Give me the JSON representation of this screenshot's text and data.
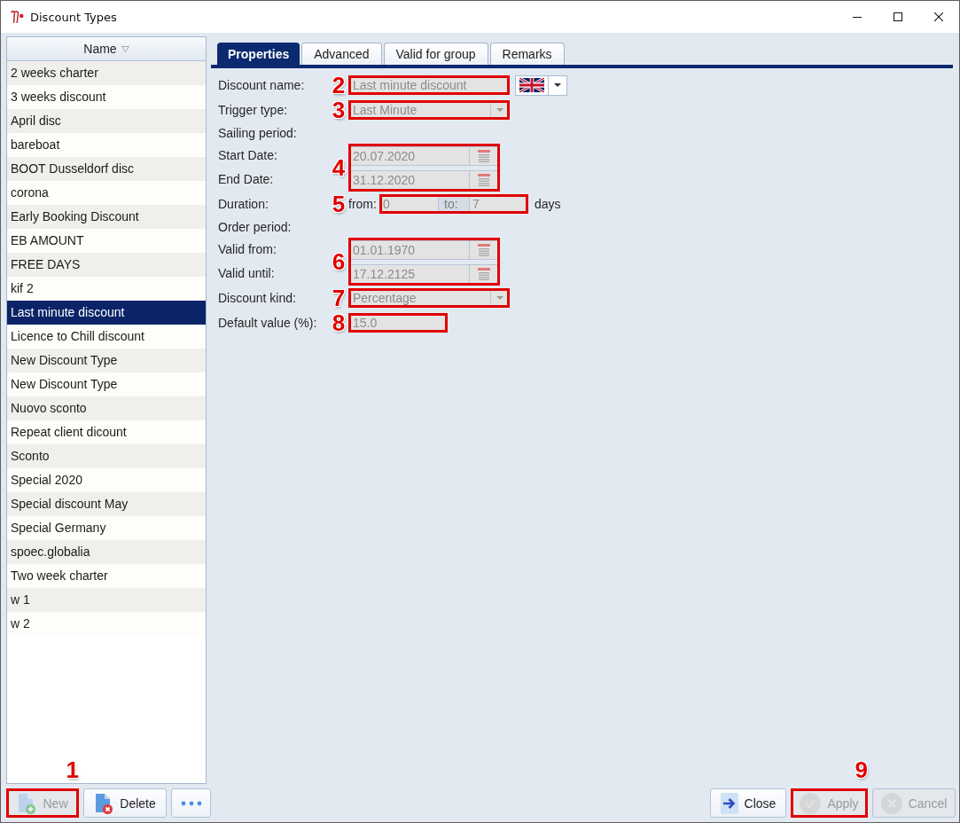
{
  "window": {
    "title": "Discount Types"
  },
  "list": {
    "header": "Name",
    "items": [
      {
        "label": "2 weeks charter",
        "selected": false
      },
      {
        "label": "3 weeks discount",
        "selected": false
      },
      {
        "label": "April disc",
        "selected": false
      },
      {
        "label": "bareboat",
        "selected": false
      },
      {
        "label": "BOOT Dusseldorf disc",
        "selected": false
      },
      {
        "label": "corona",
        "selected": false
      },
      {
        "label": "Early Booking Discount",
        "selected": false
      },
      {
        "label": "EB AMOUNT",
        "selected": false
      },
      {
        "label": "FREE DAYS",
        "selected": false
      },
      {
        "label": "kif 2",
        "selected": false
      },
      {
        "label": "Last minute discount",
        "selected": true
      },
      {
        "label": "Licence to Chill discount",
        "selected": false
      },
      {
        "label": "New Discount Type",
        "selected": false
      },
      {
        "label": "New Discount Type",
        "selected": false
      },
      {
        "label": "Nuovo sconto",
        "selected": false
      },
      {
        "label": "Repeat client dicount",
        "selected": false
      },
      {
        "label": "Sconto",
        "selected": false
      },
      {
        "label": "Special 2020",
        "selected": false
      },
      {
        "label": "Special discount May",
        "selected": false
      },
      {
        "label": "Special Germany",
        "selected": false
      },
      {
        "label": "spoec.globalia",
        "selected": false
      },
      {
        "label": "Two week charter",
        "selected": false
      },
      {
        "label": "w 1",
        "selected": false
      },
      {
        "label": "w 2",
        "selected": false
      }
    ]
  },
  "list_buttons": [
    {
      "kind": "new",
      "label": "New",
      "disabled": true,
      "callout": "1"
    },
    {
      "kind": "delete",
      "label": "Delete",
      "disabled": false
    },
    {
      "kind": "more",
      "disabled": false
    }
  ],
  "tabs": [
    {
      "label": "Properties",
      "selected": true
    },
    {
      "label": "Advanced",
      "selected": false
    },
    {
      "label": "Valid for group",
      "selected": false
    },
    {
      "label": "Remarks",
      "selected": false
    }
  ],
  "form": [
    {
      "kind": "text",
      "label": "Discount name:",
      "value": "Last minute discount",
      "disabled": true,
      "callout": "2",
      "language": true
    },
    {
      "kind": "combo",
      "label": "Trigger type:",
      "value": "Last Minute",
      "disabled": true,
      "callout": "3"
    },
    {
      "kind": "section",
      "label": "Sailing period:"
    },
    {
      "kind": "dates",
      "callout": "4",
      "fields": [
        {
          "label": "Start Date:",
          "value": "20.07.2020",
          "disabled": true
        },
        {
          "label": "End Date:",
          "value": "31.12.2020",
          "disabled": true
        }
      ]
    },
    {
      "kind": "range",
      "label": "Duration:",
      "from_label": "from:",
      "from": "0",
      "to_label": "to:",
      "to": "7",
      "unit": "days",
      "disabled": true,
      "callout": "5"
    },
    {
      "kind": "section",
      "label": "Order period:"
    },
    {
      "kind": "dates",
      "callout": "6",
      "fields": [
        {
          "label": "Valid from:",
          "value": "01.01.1970",
          "disabled": true
        },
        {
          "label": "Valid until:",
          "value": "17.12.2125",
          "disabled": true
        }
      ]
    },
    {
      "kind": "combo",
      "label": "Discount kind:",
      "value": "Percentage",
      "disabled": true,
      "callout": "7"
    },
    {
      "kind": "number",
      "label": "Default value (%):",
      "value": "15.0",
      "disabled": true,
      "callout": "8"
    }
  ],
  "footer_buttons": [
    {
      "kind": "close",
      "label": "Close",
      "disabled": false
    },
    {
      "kind": "apply",
      "label": "Apply",
      "disabled": true,
      "callout": "9"
    },
    {
      "kind": "cancel",
      "label": "Cancel",
      "disabled": true
    }
  ]
}
